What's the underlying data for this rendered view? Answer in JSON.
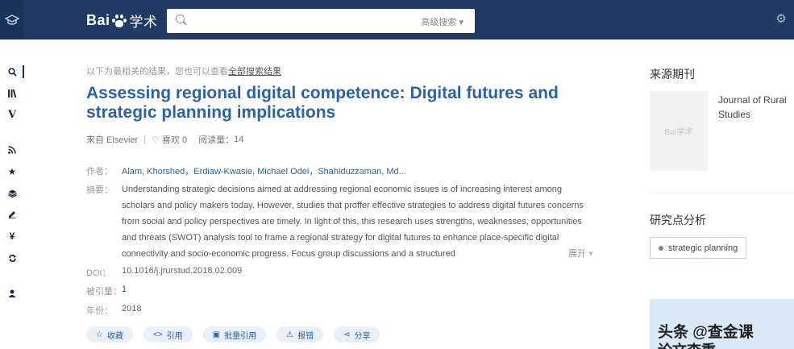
{
  "header": {
    "logo_text_a": "Bai",
    "logo_text_b": "学术",
    "search_value": "",
    "advanced_search": "高级搜索"
  },
  "sidebar_icons": [
    "search-icon",
    "library-icon",
    "v-icon",
    "rss-icon",
    "star-icon",
    "layers-icon",
    "edit-icon",
    "yen-icon",
    "refresh-icon",
    "user-icon"
  ],
  "result": {
    "hint_text": "以下为最相关的结果，您也可以查看",
    "hint_link": "全部搜索结果",
    "title": "Assessing regional digital competence: Digital futures and strategic planning implications",
    "source": "来自 Elsevier",
    "likes_label": "喜欢 0",
    "reads_label": "阅读量：",
    "reads_count": "14",
    "authors_label": "作者：",
    "authors": "Alam, Khorshed，Erdiaw-Kwasie, Michael Odei，Shahiduzzaman, Md...",
    "abstract_label": "摘要：",
    "abstract": "Understanding strategic decisions aimed at addressing regional economic issues is of increasing interest among scholars and policy makers today. However, studies that proffer effective strategies to address digital futures concerns from social and policy perspectives are timely. In light of this, this research uses strengths, weaknesses, opportunities and threats (SWOT) analysis tool to frame a regional strategy for digital futures to enhance place-specific digital connectivity and socio-economic progress. Focus group discussions and a structured",
    "expand": "展开",
    "doi_label": "DOI：",
    "doi": "10.1016/j.jrurstud.2018.02.009",
    "cited_label": "被引量：",
    "cited": "1",
    "year_label": "年份：",
    "year": "2018"
  },
  "actions": {
    "collect": "收藏",
    "cite": "引用",
    "batch_cite": "批量引用",
    "report": "报错",
    "share": "分享"
  },
  "side": {
    "source_title": "来源期刊",
    "journal_name": "Journal of Rural Studies",
    "cover_logo": "Bai学术",
    "analysis_title": "研究点分析",
    "tag": "strategic planning",
    "watermark": "头条 @查金课",
    "watermark2": "论文查重"
  }
}
